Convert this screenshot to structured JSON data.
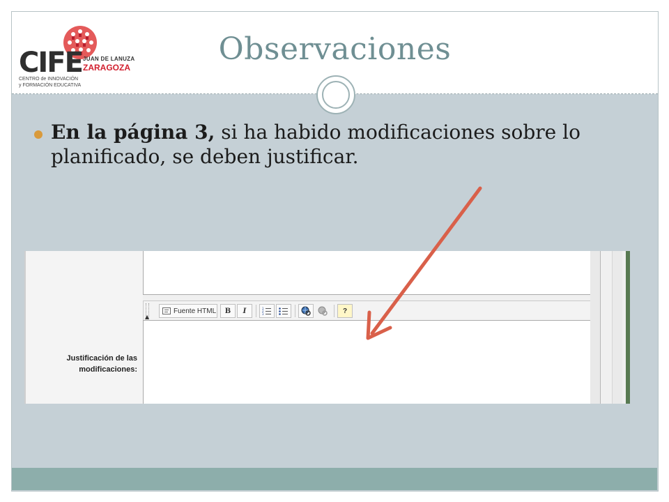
{
  "slide": {
    "title": "Observaciones",
    "bullet": {
      "bold_part": "En la página 3,",
      "rest": " si ha habido modificaciones sobre lo planificado, se deben justificar."
    }
  },
  "logo": {
    "cife": "CIFE",
    "juan": "JUAN DE LANUZA",
    "zaragoza": "ZARAGOZA",
    "centro_line1": "CENTRO de INNOVACIÓN",
    "centro_line2": "y FORMACIÓN EDUCATIVA"
  },
  "embedded_screenshot": {
    "toolbar": {
      "source_button": "Fuente HTML",
      "bold_button": "B",
      "italic_button": "I",
      "help_button": "?"
    },
    "field_label_line1": "Justificación de las",
    "field_label_line2": "modificaciones:"
  },
  "colors": {
    "title": "#6f8f93",
    "bullet": "#d99a3c",
    "arrow": "#d9604a",
    "footer": "#8daeab",
    "content_bg": "#c5d0d6"
  }
}
